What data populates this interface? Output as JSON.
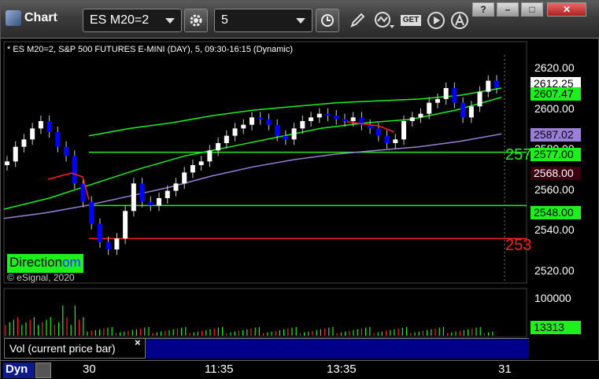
{
  "titlebar": {
    "app_title": "Chart",
    "symbol": "ES M20=2",
    "interval": "5",
    "get_label": "GET"
  },
  "chart": {
    "title": "* ES M20=2, S&P 500 FUTURES E-MINI (DAY), 5, 09:30-16:15 (Dynamic)",
    "watermark": "© eSignal, 2020",
    "badge_text": "Direction",
    "badge_tail": "om",
    "big_labels": {
      "green": "257",
      "red": "253"
    },
    "price_tags": [
      {
        "value": "2612.25",
        "bg": "#ffffff",
        "fg": "#000000"
      },
      {
        "value": "2607.47",
        "bg": "#1ef01e",
        "fg": "#000000"
      },
      {
        "value": "2587.02",
        "bg": "#9b7fd6",
        "fg": "#000000"
      },
      {
        "value": "2577.00",
        "bg": "#1ef01e",
        "fg": "#000000"
      },
      {
        "value": "2568.00",
        "bg": "#3a0010",
        "fg": "#ffffff"
      },
      {
        "value": "2548.00",
        "bg": "#1ef01e",
        "fg": "#000000"
      }
    ],
    "volume_panel": {
      "title": "Vol (current price bar)",
      "close": "×",
      "axis_top": "100000",
      "current_value": "13313"
    }
  },
  "chart_data": {
    "type": "line",
    "title": "* ES M20=2, S&P 500 FUTURES E-MINI (DAY), 5, 09:30-16:15 (Dynamic)",
    "xlabel": "",
    "ylabel": "",
    "ylim": [
      2510,
      2630
    ],
    "y_ticks": [
      "2620.00",
      "2600.00",
      "2580.00",
      "2560.00",
      "2540.00",
      "2520.00"
    ],
    "x_ticks": [
      "30",
      "11:35",
      "13:35",
      "31"
    ],
    "horizontal_levels": [
      {
        "value": 2577.0,
        "color": "#1ef01e"
      },
      {
        "value": 2548.0,
        "color": "#1ef01e"
      },
      {
        "value": 2530.0,
        "color": "#ff2020"
      }
    ],
    "series": [
      {
        "values": [
          2586,
          2590,
          2593,
          2597,
          2600,
          2602,
          2604,
          2605,
          2606,
          2608,
          2612
        ]
      },
      {
        "values": [
          2546,
          2552,
          2560,
          2568,
          2575,
          2580,
          2585,
          2590,
          2593,
          2595,
          2600,
          2607
        ]
      },
      {
        "values": [
          2541,
          2544,
          2548,
          2553,
          2558,
          2564,
          2569,
          2573,
          2576,
          2578,
          2580,
          2583,
          2587
        ]
      }
    ],
    "volume_ylim": [
      0,
      100000
    ]
  },
  "bottombar": {
    "dyn_label": "Dyn"
  },
  "colors": {
    "green": "#1ef01e",
    "red": "#ff2020",
    "blue": "#0000ff",
    "purple": "#9b7fd6"
  }
}
